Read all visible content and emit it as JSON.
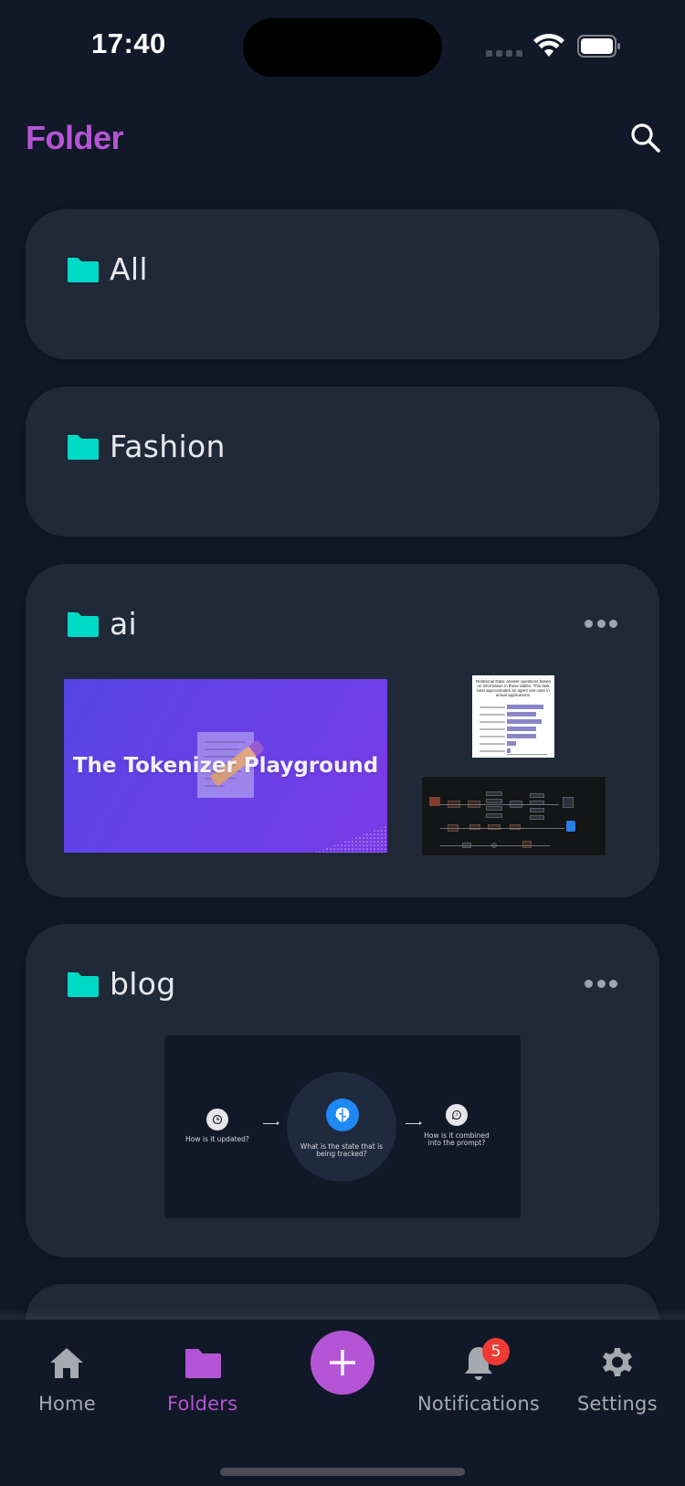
{
  "status_bar": {
    "time": "17:40"
  },
  "header": {
    "title": "Folder",
    "search_icon": "search-icon"
  },
  "colors": {
    "accent": "#b455d6",
    "folder_icon": "#00d9c8",
    "card_bg": "#202938",
    "page_bg": "#111827",
    "badge": "#ee3a35"
  },
  "folders": [
    {
      "name": "All",
      "has_menu": false,
      "thumbnails": []
    },
    {
      "name": "Fashion",
      "has_menu": false,
      "thumbnails": []
    },
    {
      "name": "ai",
      "has_menu": true,
      "thumbnails": [
        {
          "title": "The Tokenizer Playground",
          "kind": "banner"
        },
        {
          "title": "Relational Data: answer questions based on information in these tables. This task best approximates an agent use case in actual applications.",
          "kind": "bar-chart"
        },
        {
          "title": "",
          "kind": "architecture-diagram"
        }
      ]
    },
    {
      "name": "blog",
      "has_menu": true,
      "thumbnails": [
        {
          "kind": "concept-diagram",
          "left_caption": "How is it updated?",
          "center_caption": "What is the state that is being tracked?",
          "right_caption": "How is it combined into the prompt?"
        }
      ]
    }
  ],
  "bottom_nav": {
    "items": [
      {
        "label": "Home",
        "icon": "home-icon",
        "active": false
      },
      {
        "label": "Folders",
        "icon": "folder-icon",
        "active": true
      },
      {
        "label": "Notifications",
        "icon": "bell-icon",
        "active": false,
        "badge": "5"
      },
      {
        "label": "Settings",
        "icon": "gear-icon",
        "active": false
      }
    ],
    "fab_icon": "plus-icon"
  }
}
